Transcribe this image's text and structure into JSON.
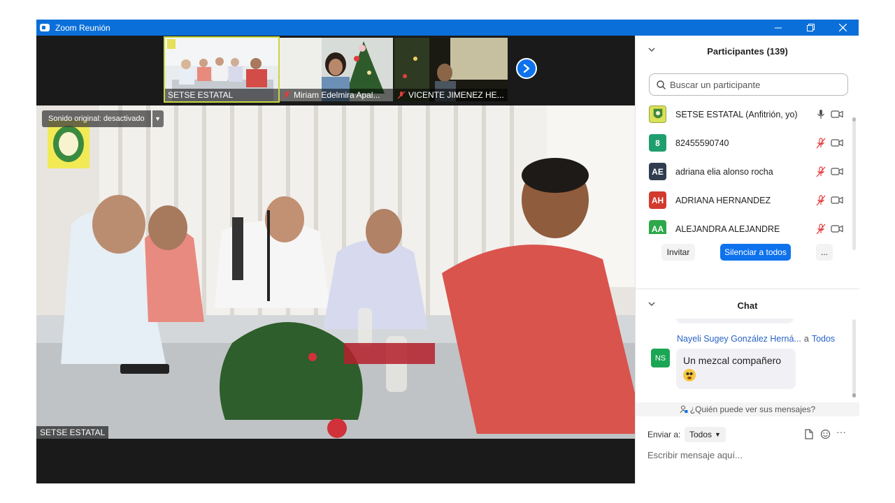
{
  "window": {
    "title": "Zoom Reunión"
  },
  "thumbnails": [
    {
      "name": "SETSE ESTATAL",
      "muted": false
    },
    {
      "name": "Miriam Edelmira Apal...",
      "muted": true
    },
    {
      "name": "VICENTE JIMENEZ HE...",
      "muted": true
    }
  ],
  "main_video": {
    "original_sound": "Sonido original: desactivado",
    "speaker_label": "SETSE ESTATAL"
  },
  "participants": {
    "title": "Participantes (139)",
    "search_placeholder": "Buscar un participante",
    "list": [
      {
        "initials": "",
        "name": "SETSE ESTATAL (Anfitrión, yo)",
        "avatar_color": "#d8e35a",
        "mic": "on"
      },
      {
        "initials": "8",
        "name": "82455590740",
        "avatar_color": "#1f9e6e",
        "mic": "muted"
      },
      {
        "initials": "AE",
        "name": "adriana elia alonso rocha",
        "avatar_color": "#2f3d4f",
        "mic": "muted"
      },
      {
        "initials": "AH",
        "name": "ADRIANA HERNANDEZ",
        "avatar_color": "#d23a2e",
        "mic": "muted"
      },
      {
        "initials": "AA",
        "name": "ALEJANDRA ALEJANDRE",
        "avatar_color": "#2ea84a",
        "mic": "muted"
      }
    ],
    "invite_label": "Invitar",
    "mute_all_label": "Silenciar a todos",
    "more_label": "..."
  },
  "chat": {
    "title": "Chat",
    "message": {
      "avatar_initials": "NS",
      "sender": "Nayeli Sugey González Herná...",
      "to_word": "a",
      "recipient": "Todos",
      "text": "Un mezcal compañero"
    },
    "who_can_see": "¿Quién puede ver sus mensajes?",
    "send_to_label": "Enviar a:",
    "send_to_value": "Todos",
    "input_placeholder": "Escribir mensaje aquí...",
    "more_label": "···"
  },
  "colors": {
    "titlebar": "#0b6fd9",
    "accent": "#0e72ed",
    "muted_mic": "#e23c3c"
  }
}
